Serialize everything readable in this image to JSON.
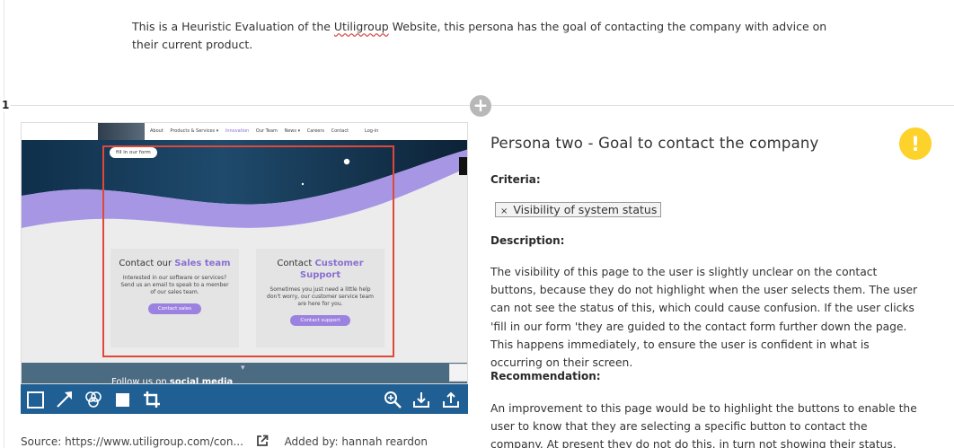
{
  "intro": {
    "before": "This is a Heuristic Evaluation of the ",
    "company": "Utiligroup",
    "after": " Website, this persona has the goal of contacting the company with advice on their current product."
  },
  "step": {
    "number": "1",
    "add_symbol": "+"
  },
  "screenshot": {
    "nav_links": [
      "About",
      "Products & Services ▾",
      "Innovation",
      "Our Team",
      "News ▾",
      "Careers",
      "Contact"
    ],
    "active_nav": "Innovation",
    "login": "Log-in",
    "fill_pill": "fill in our form",
    "sales_card": {
      "title_prefix": "Contact our ",
      "title_highlight": "Sales team",
      "body": "Interested in our software or services? Send us an email to speak to a member of our sales team.",
      "button": "Contact sales"
    },
    "support_card": {
      "title_prefix": "Contact ",
      "title_highlight": "Customer Support",
      "body": "Sometimes you just need a little help don't worry, our customer service team are here for you.",
      "button": "Contact support"
    },
    "follow_prefix": "Follow us on ",
    "follow_bold": "social media"
  },
  "toolbar": {
    "tools": [
      "rectangle-icon",
      "arrow-icon",
      "blur-icon",
      "filled-rectangle-icon",
      "crop-icon",
      "zoom-in-icon",
      "download-icon",
      "upload-icon"
    ]
  },
  "source": {
    "label": "Source:",
    "url": "https://www.utiligroup.com/con...",
    "added_by": "Added by: hannah reardon"
  },
  "finding": {
    "title": "Persona two - Goal to contact the company",
    "severity_symbol": "!",
    "criteria_label": "Criteria:",
    "criteria_tag": "Visibility of system status",
    "criteria_remove": "×",
    "description_label": "Description:",
    "description": "The visibility of this page to the user is slightly unclear on the contact buttons, because they do not highlight when the user selects them. The user can not see the status of this, which could cause confusion. If the user clicks 'fill in our form 'they are guided to the contact form further down the page. This happens immediately, to ensure the user is confident in what is occurring on their screen.",
    "recommendation_label": "Recommendation:",
    "recommendation": "An improvement to this page would be to highlight the buttons to enable the user to know that they are selecting a specific button to contact the company. At present they do not do this, in turn not showing their status."
  },
  "colors": {
    "toolbar": "#1f5f93",
    "accent_purple": "#8a6fd1",
    "warning": "#fcd22b",
    "annotation_red": "#e0483a"
  }
}
